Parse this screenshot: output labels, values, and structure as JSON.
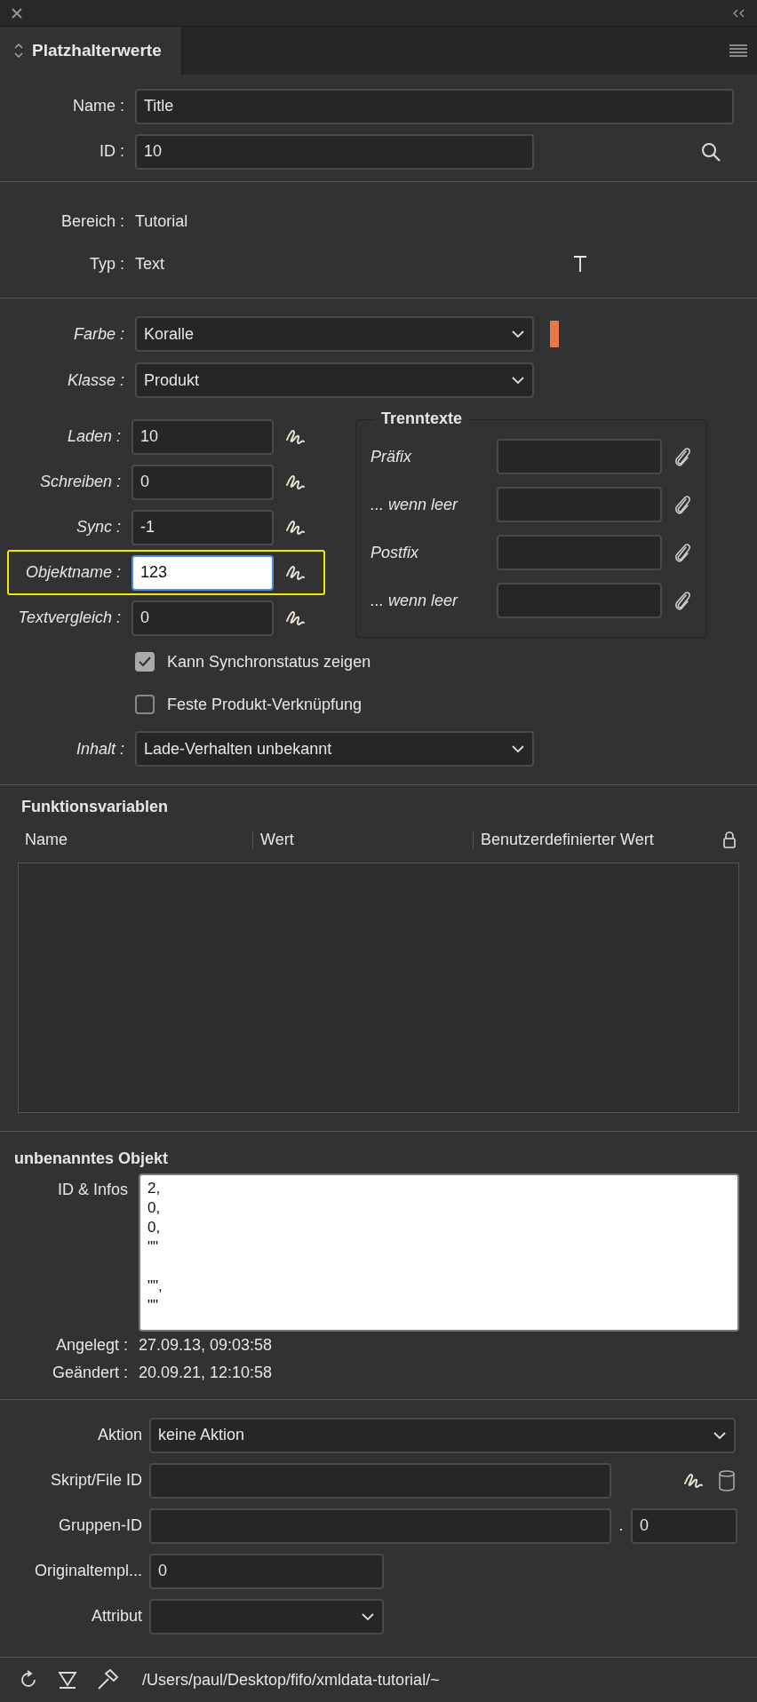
{
  "panel_tab": {
    "title": "Platzhalterwerte",
    "selected": true
  },
  "identity": [
    {
      "label": "Name :",
      "value": "Title",
      "kind": "wide"
    },
    {
      "label": "ID :",
      "value": "10",
      "kind": "search"
    }
  ],
  "info": [
    {
      "label": "Bereich :",
      "value": "Tutorial"
    },
    {
      "label": "Typ :",
      "value": "Text"
    }
  ],
  "farbe": {
    "label": "Farbe :",
    "value": "Koralle",
    "color": "#e8774a"
  },
  "klasse": {
    "label": "Klasse :",
    "value": "Produkt"
  },
  "scripts": [
    {
      "label": "Laden :",
      "value": "10",
      "focused": false
    },
    {
      "label": "Schreiben :",
      "value": "0",
      "focused": false
    },
    {
      "label": "Sync :",
      "value": "-1",
      "focused": false
    },
    {
      "label": "Objektname :",
      "value": "123",
      "focused": true
    },
    {
      "label": "Textvergleich :",
      "value": "0",
      "focused": false
    }
  ],
  "trenntexte": {
    "title": "Trenntexte",
    "rows": [
      {
        "label": "Präfix"
      },
      {
        "label": "... wenn leer"
      },
      {
        "label": "Postfix"
      },
      {
        "label": "... wenn leer"
      }
    ]
  },
  "options": [
    {
      "label": "Kann Synchronstatus zeigen",
      "checked": true
    },
    {
      "label": "Feste Produkt-Verknüpfung",
      "checked": false
    }
  ],
  "inhalt": {
    "label": "Inhalt :",
    "value": "Lade-Verhalten unbekannt"
  },
  "funktionsvariablen": {
    "title": "Funktionsvariablen",
    "columns": [
      "Name",
      "Wert",
      "Benutzerdefinierter Wert"
    ]
  },
  "objekt": {
    "title": "unbenanntes Objekt",
    "infos_label": "ID & Infos",
    "infos": "2,\n0,\n0,\n\"\"\n\n\"\",\n\"\""
  },
  "dates": [
    {
      "label": "Angelegt :",
      "value": "27.09.13, 09:03:58"
    },
    {
      "label": "Geändert :",
      "value": "20.09.21, 12:10:58"
    }
  ],
  "aktion": {
    "label": "Aktion",
    "value": "keine Aktion"
  },
  "skript": {
    "label": "Skript/File ID"
  },
  "gruppe": {
    "label": "Gruppen-ID",
    "separator": ".",
    "sub_value": "0"
  },
  "original": {
    "label": "Originaltempl...",
    "value": "0"
  },
  "attribut": {
    "label": "Attribut"
  },
  "status_bar": {
    "path": "/Users/paul/Desktop/fifo/xmldata-tutorial/~"
  }
}
